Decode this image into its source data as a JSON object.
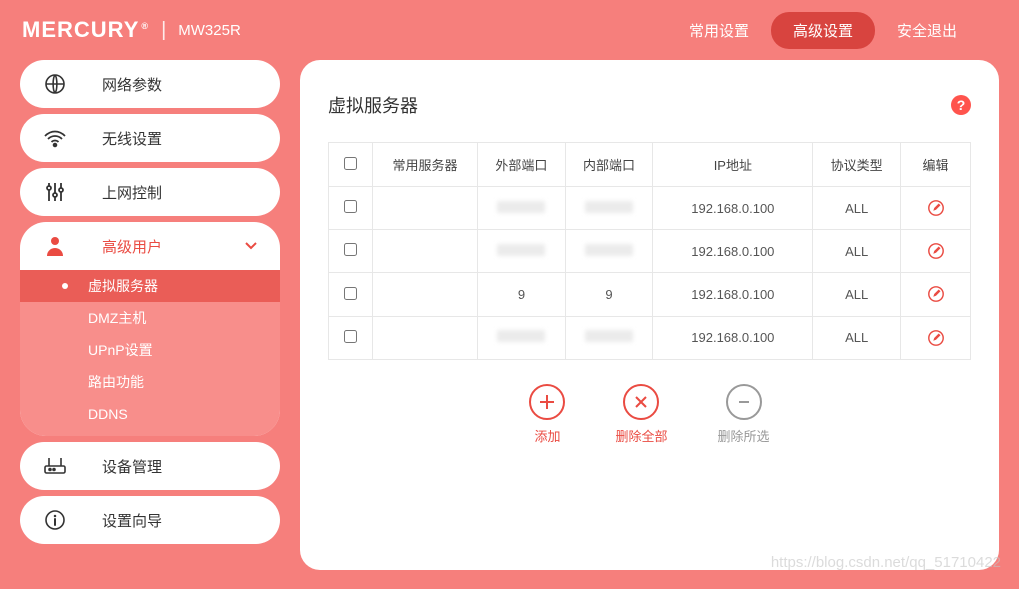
{
  "header": {
    "brand": "MERCURY",
    "model": "MW325R",
    "nav": {
      "basic": "常用设置",
      "advanced": "高级设置",
      "logout": "安全退出"
    }
  },
  "sidebar": {
    "network": "网络参数",
    "wireless": "无线设置",
    "access": "上网控制",
    "advanced_user": "高级用户",
    "sub": {
      "vserver": "虚拟服务器",
      "dmz": "DMZ主机",
      "upnp": "UPnP设置",
      "route": "路由功能",
      "ddns": "DDNS"
    },
    "device": "设备管理",
    "wizard": "设置向导"
  },
  "page": {
    "title": "虚拟服务器"
  },
  "table": {
    "headers": {
      "service": "常用服务器",
      "ext_port": "外部端口",
      "int_port": "内部端口",
      "ip": "IP地址",
      "protocol": "协议类型",
      "edit": "编辑"
    },
    "rows": [
      {
        "service": "",
        "ext_port": "",
        "int_port": "",
        "ip": "192.168.0.100",
        "protocol": "ALL"
      },
      {
        "service": "",
        "ext_port": "",
        "int_port": "",
        "ip": "192.168.0.100",
        "protocol": "ALL"
      },
      {
        "service": "",
        "ext_port": "9",
        "int_port": "9",
        "ip": "192.168.0.100",
        "protocol": "ALL"
      },
      {
        "service": "",
        "ext_port": "",
        "int_port": "",
        "ip": "192.168.0.100",
        "protocol": "ALL"
      }
    ]
  },
  "actions": {
    "add": "添加",
    "delete_all": "删除全部",
    "delete_selected": "删除所选"
  },
  "watermark": "https://blog.csdn.net/qq_51710422"
}
